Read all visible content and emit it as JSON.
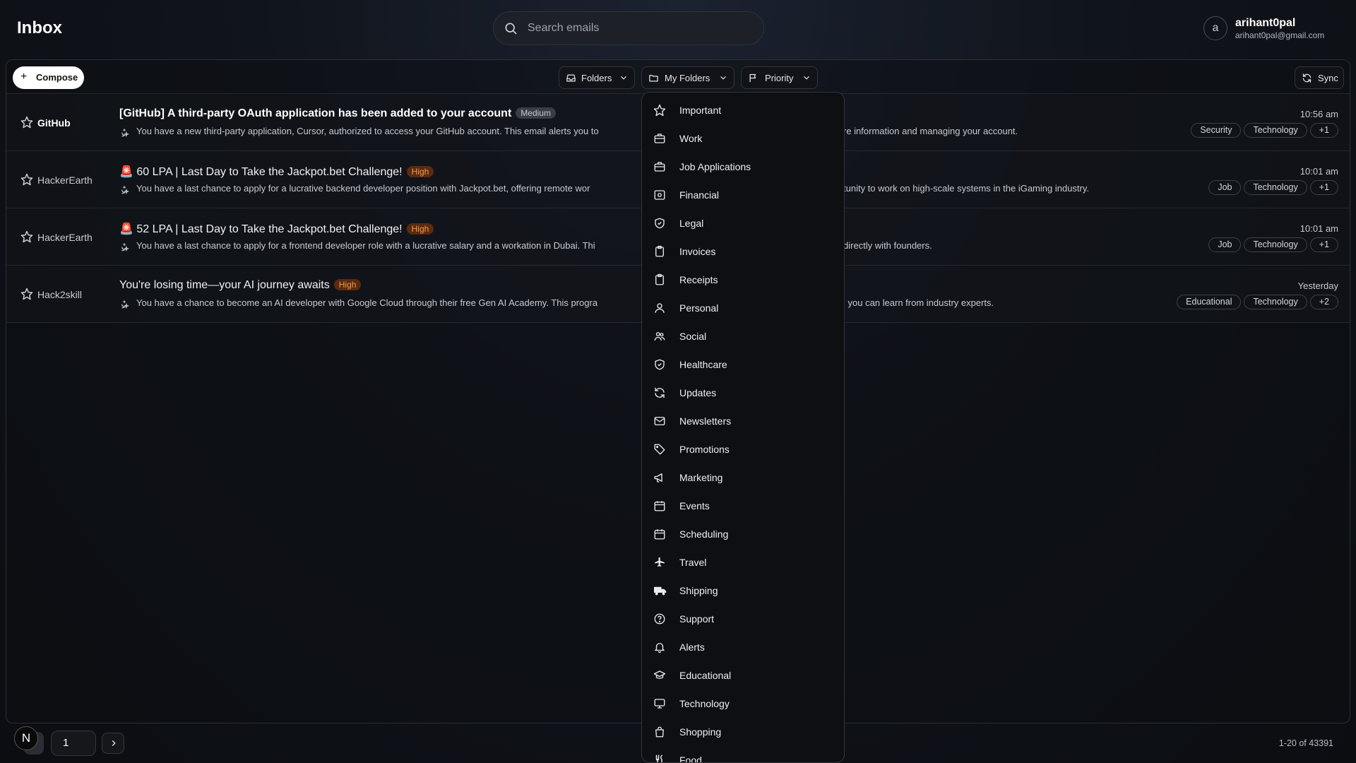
{
  "header": {
    "title": "Inbox",
    "search_placeholder": "Search emails",
    "user": {
      "avatar_letter": "a",
      "name": "arihant0pal",
      "email": "arihant0pal@gmail.com"
    }
  },
  "toolbar": {
    "compose_label": "Compose",
    "folders_label": "Folders",
    "my_folders_label": "My Folders",
    "priority_label": "Priority",
    "sync_label": "Sync"
  },
  "emails": [
    {
      "sender": "GitHub",
      "unread": true,
      "subject": "[GitHub] A third-party OAuth application has been added to your account",
      "priority": "Medium",
      "snippet_left": "You have a new third-party application, Cursor, authorized to access your GitHub account. This email alerts you to",
      "snippet_right": "re information and managing your account.",
      "time": "10:56 am",
      "tags": [
        "Security",
        "Technology",
        "+1"
      ]
    },
    {
      "sender": "HackerEarth",
      "unread": false,
      "subject": "🚨 60 LPA | Last Day to Take the Jackpot.bet Challenge!",
      "priority": "High",
      "snippet_left": "You have a last chance to apply for a lucrative backend developer position with Jackpot.bet, offering remote wor",
      "snippet_right": "tunity to work on high-scale systems in the iGaming industry.",
      "time": "10:01 am",
      "tags": [
        "Job",
        "Technology",
        "+1"
      ]
    },
    {
      "sender": "HackerEarth",
      "unread": false,
      "subject": "🚨 52 LPA | Last Day to Take the Jackpot.bet Challenge!",
      "priority": "High",
      "snippet_left": "You have a last chance to apply for a frontend developer role with a lucrative salary and a workation in Dubai. Thi",
      "snippet_right": "directly with founders.",
      "time": "10:01 am",
      "tags": [
        "Job",
        "Technology",
        "+1"
      ]
    },
    {
      "sender": "Hack2skill",
      "unread": false,
      "subject": "You're losing time—your AI journey awaits",
      "priority": "High",
      "snippet_left": "You have a chance to become an AI developer with Google Cloud through their free Gen AI Academy. This progra",
      "snippet_right": "l you can learn from industry experts.",
      "time": "Yesterday",
      "tags": [
        "Educational",
        "Technology",
        "+2"
      ]
    }
  ],
  "my_folders_menu": [
    {
      "label": "Important",
      "icon": "star-icon"
    },
    {
      "label": "Work",
      "icon": "briefcase-icon"
    },
    {
      "label": "Job Applications",
      "icon": "briefcase-icon"
    },
    {
      "label": "Financial",
      "icon": "banknote-icon"
    },
    {
      "label": "Legal",
      "icon": "shield-check-icon"
    },
    {
      "label": "Invoices",
      "icon": "clipboard-icon"
    },
    {
      "label": "Receipts",
      "icon": "clipboard-icon"
    },
    {
      "label": "Personal",
      "icon": "user-icon"
    },
    {
      "label": "Social",
      "icon": "users-icon"
    },
    {
      "label": "Healthcare",
      "icon": "shield-check-icon"
    },
    {
      "label": "Updates",
      "icon": "refresh-icon"
    },
    {
      "label": "Newsletters",
      "icon": "mail-icon"
    },
    {
      "label": "Promotions",
      "icon": "tag-icon"
    },
    {
      "label": "Marketing",
      "icon": "megaphone-icon"
    },
    {
      "label": "Events",
      "icon": "calendar-icon"
    },
    {
      "label": "Scheduling",
      "icon": "calendar-icon"
    },
    {
      "label": "Travel",
      "icon": "plane-icon"
    },
    {
      "label": "Shipping",
      "icon": "truck-icon"
    },
    {
      "label": "Support",
      "icon": "help-circle-icon"
    },
    {
      "label": "Alerts",
      "icon": "bell-icon"
    },
    {
      "label": "Educational",
      "icon": "graduation-cap-icon"
    },
    {
      "label": "Technology",
      "icon": "monitor-icon"
    },
    {
      "label": "Shopping",
      "icon": "shopping-bag-icon"
    },
    {
      "label": "Food",
      "icon": "utensils-icon"
    }
  ],
  "pagination": {
    "avatar_letter": "N",
    "page": "1",
    "count_text": "1-20 of 43391"
  },
  "colors": {
    "priority_high": "#f09a4a",
    "priority_medium": "#c4c7cc",
    "background": "#0b0d11"
  }
}
